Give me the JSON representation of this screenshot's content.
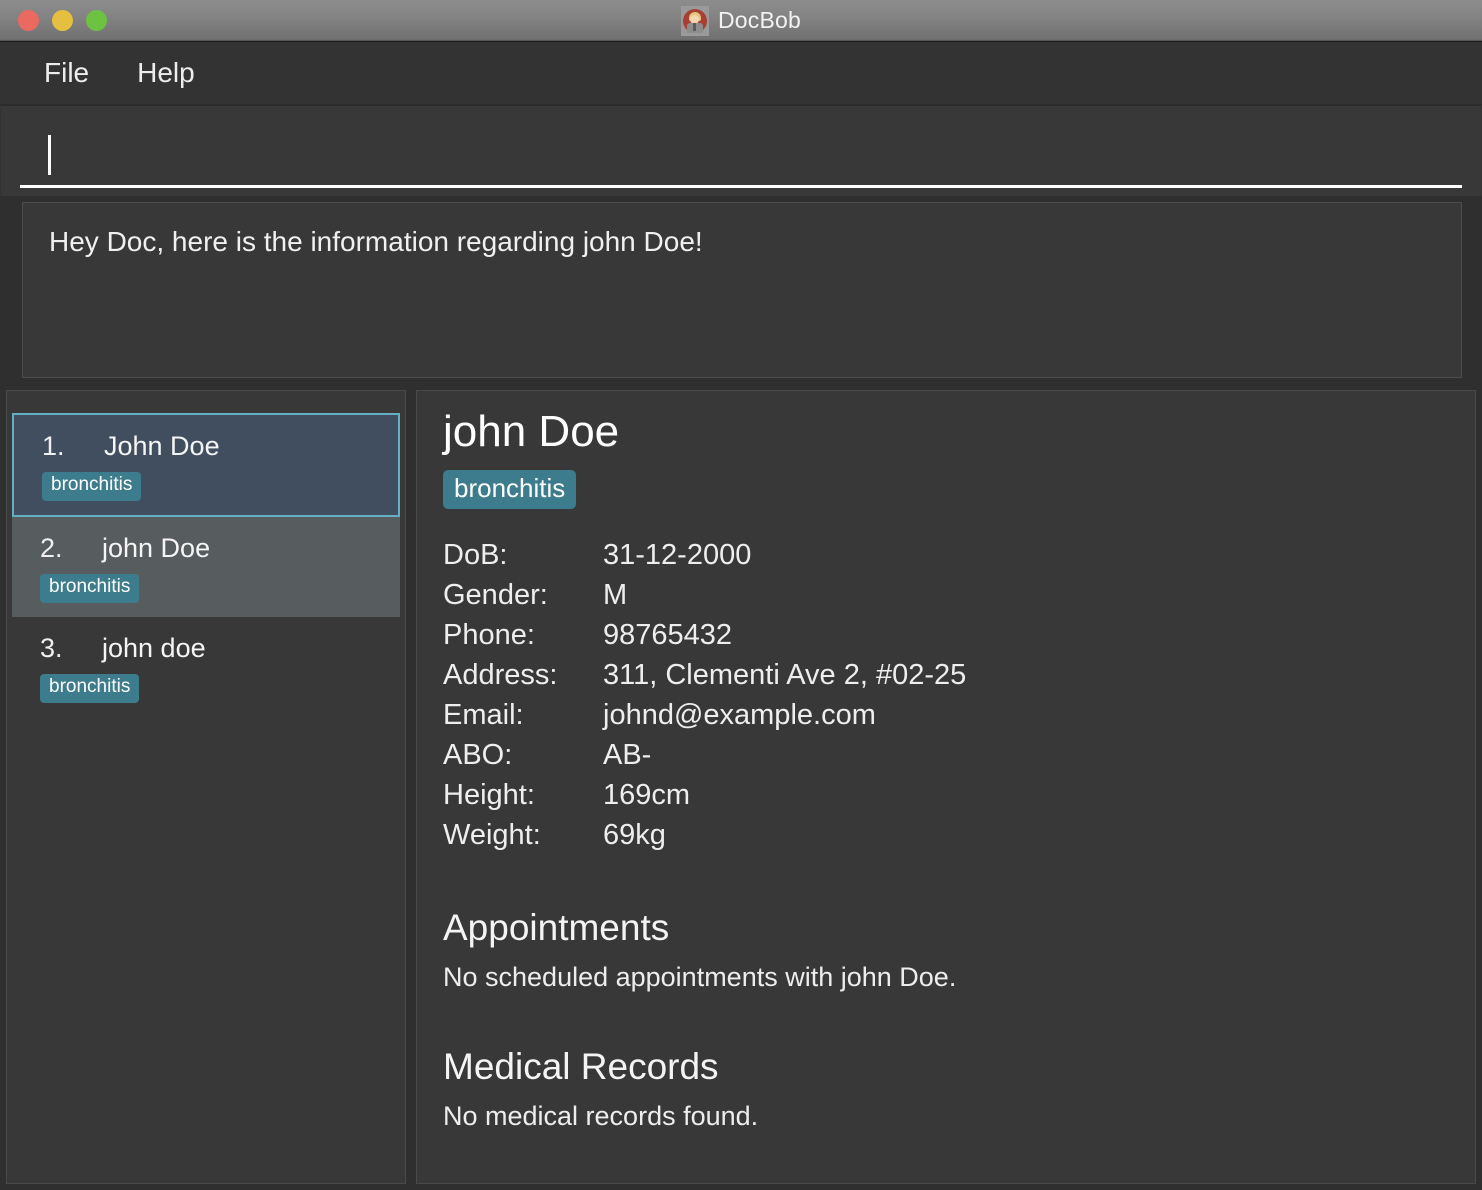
{
  "titlebar": {
    "app_title": "DocBob",
    "icon": "app-avatar-icon",
    "buttons": {
      "close": "close-window-button",
      "minimize": "minimize-window-button",
      "maximize": "maximize-window-button"
    },
    "colors": {
      "close": "#ea6a61",
      "minimize": "#e4bf40",
      "maximize": "#6ec241"
    }
  },
  "menubar": {
    "items": [
      {
        "label": "File"
      },
      {
        "label": "Help"
      }
    ]
  },
  "command_input": {
    "value": "",
    "placeholder": ""
  },
  "response": {
    "message": "Hey Doc, here is the information regarding john Doe!"
  },
  "sidebar": {
    "items": [
      {
        "index": "1.",
        "name": "John Doe",
        "tag": "bronchitis",
        "state": "selected"
      },
      {
        "index": "2.",
        "name": "john Doe",
        "tag": "bronchitis",
        "state": "hovered"
      },
      {
        "index": "3.",
        "name": "john doe",
        "tag": "bronchitis",
        "state": "normal"
      }
    ]
  },
  "detail": {
    "name": "john Doe",
    "tag": "bronchitis",
    "fields": [
      {
        "label": "DoB:",
        "value": "31-12-2000"
      },
      {
        "label": "Gender:",
        "value": "M"
      },
      {
        "label": "Phone:",
        "value": "98765432"
      },
      {
        "label": "Address:",
        "value": "311, Clementi Ave 2, #02-25"
      },
      {
        "label": "Email:",
        "value": "johnd@example.com"
      },
      {
        "label": "ABO:",
        "value": "AB-"
      },
      {
        "label": "Height:",
        "value": "169cm"
      },
      {
        "label": "Weight:",
        "value": "69kg"
      }
    ],
    "appointments": {
      "title": "Appointments",
      "empty_text": "No scheduled appointments with john Doe."
    },
    "medical_records": {
      "title": "Medical Records",
      "empty_text": "No medical records found."
    }
  },
  "theme": {
    "window_bg": "#333333",
    "panel_bg": "#383838",
    "selected_item_bg": "#414e60",
    "selected_item_border": "#63b0c4",
    "hovered_item_bg": "#575c5e",
    "tag_bg": "#3d7c8d",
    "text": "#f0f0f0"
  }
}
